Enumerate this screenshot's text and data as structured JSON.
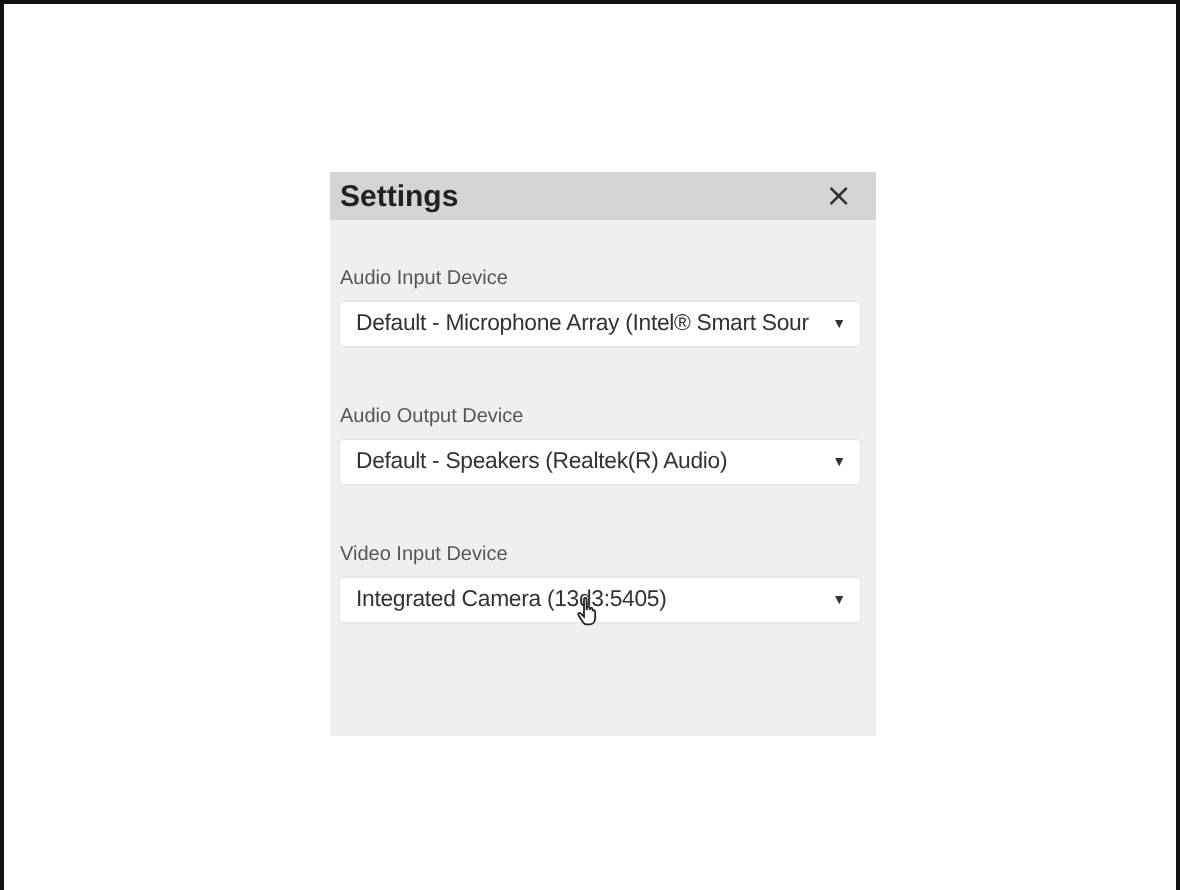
{
  "dialog": {
    "title": "Settings",
    "close": "×",
    "fields": [
      {
        "label": "Audio Input Device",
        "value": "Default - Microphone Array (Intel® Smart Sour",
        "caret": "▼"
      },
      {
        "label": "Audio Output Device",
        "value": "Default - Speakers (Realtek(R) Audio)",
        "caret": "▼"
      },
      {
        "label": "Video Input Device",
        "value": "Integrated Camera (13d3:5405)",
        "caret": "▼",
        "hovered": true
      }
    ]
  }
}
